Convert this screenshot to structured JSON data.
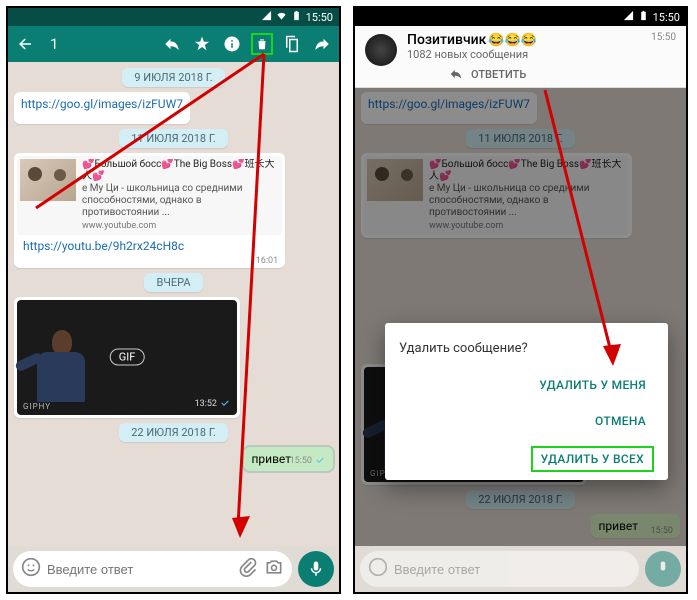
{
  "status": {
    "time": "15:50"
  },
  "selection": {
    "count": "1"
  },
  "chat": {
    "date1": "9 ИЮЛЯ 2018 Г.",
    "link1": "https://goo.gl/images/izFUW7",
    "date2": "11 ИЮЛЯ 2018 Г.",
    "card": {
      "title": "💕Большой босс💕The Big Boss💕班长大人💕",
      "desc": "е Му Ци - школьница со средними способностями, однако в противостоянии ...",
      "src": "www.youtube.com"
    },
    "link2": "https://youtu.be/9h2rx24cH8c",
    "link2_time": "16:01",
    "date3": "ВЧЕРА",
    "gif": {
      "label": "GIF",
      "src": "GIPHY",
      "time": "13:52"
    },
    "date4": "22 ИЮЛЯ 2018 Г.",
    "msg_out": "привет",
    "msg_out_time": "15:50"
  },
  "input": {
    "placeholder": "Введите ответ"
  },
  "notif": {
    "title": "Позитивчик",
    "emoji": "😂😂😂",
    "sub": "1082 новых сообщения",
    "time": "15:50",
    "reply": "ОТВЕТИТЬ"
  },
  "dialog": {
    "question": "Удалить сообщение?",
    "opt1": "УДАЛИТЬ У МЕНЯ",
    "opt2": "ОТМЕНА",
    "opt3": "УДАЛИТЬ У ВСЕХ"
  }
}
